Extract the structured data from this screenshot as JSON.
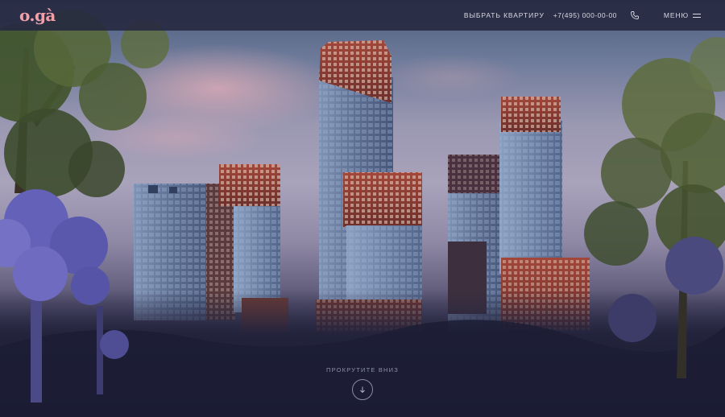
{
  "header": {
    "logo_text": "o.gà",
    "nav_choose_apartment": "Выбрать квартиру",
    "phone": "+7(495) 000-00-00",
    "phone_icon": "phone-icon",
    "menu_label": "Меню",
    "menu_icon": "hamburger-icon"
  },
  "hero": {
    "scroll_label": "Прокрутите вниз",
    "scroll_icon": "arrow-down-icon"
  },
  "colors": {
    "logo": "#f0a0a6",
    "header_bg": "#262940",
    "nav_text": "#d9d9e4",
    "brick": "#8e3a2e",
    "glass": "#6f84a8"
  }
}
